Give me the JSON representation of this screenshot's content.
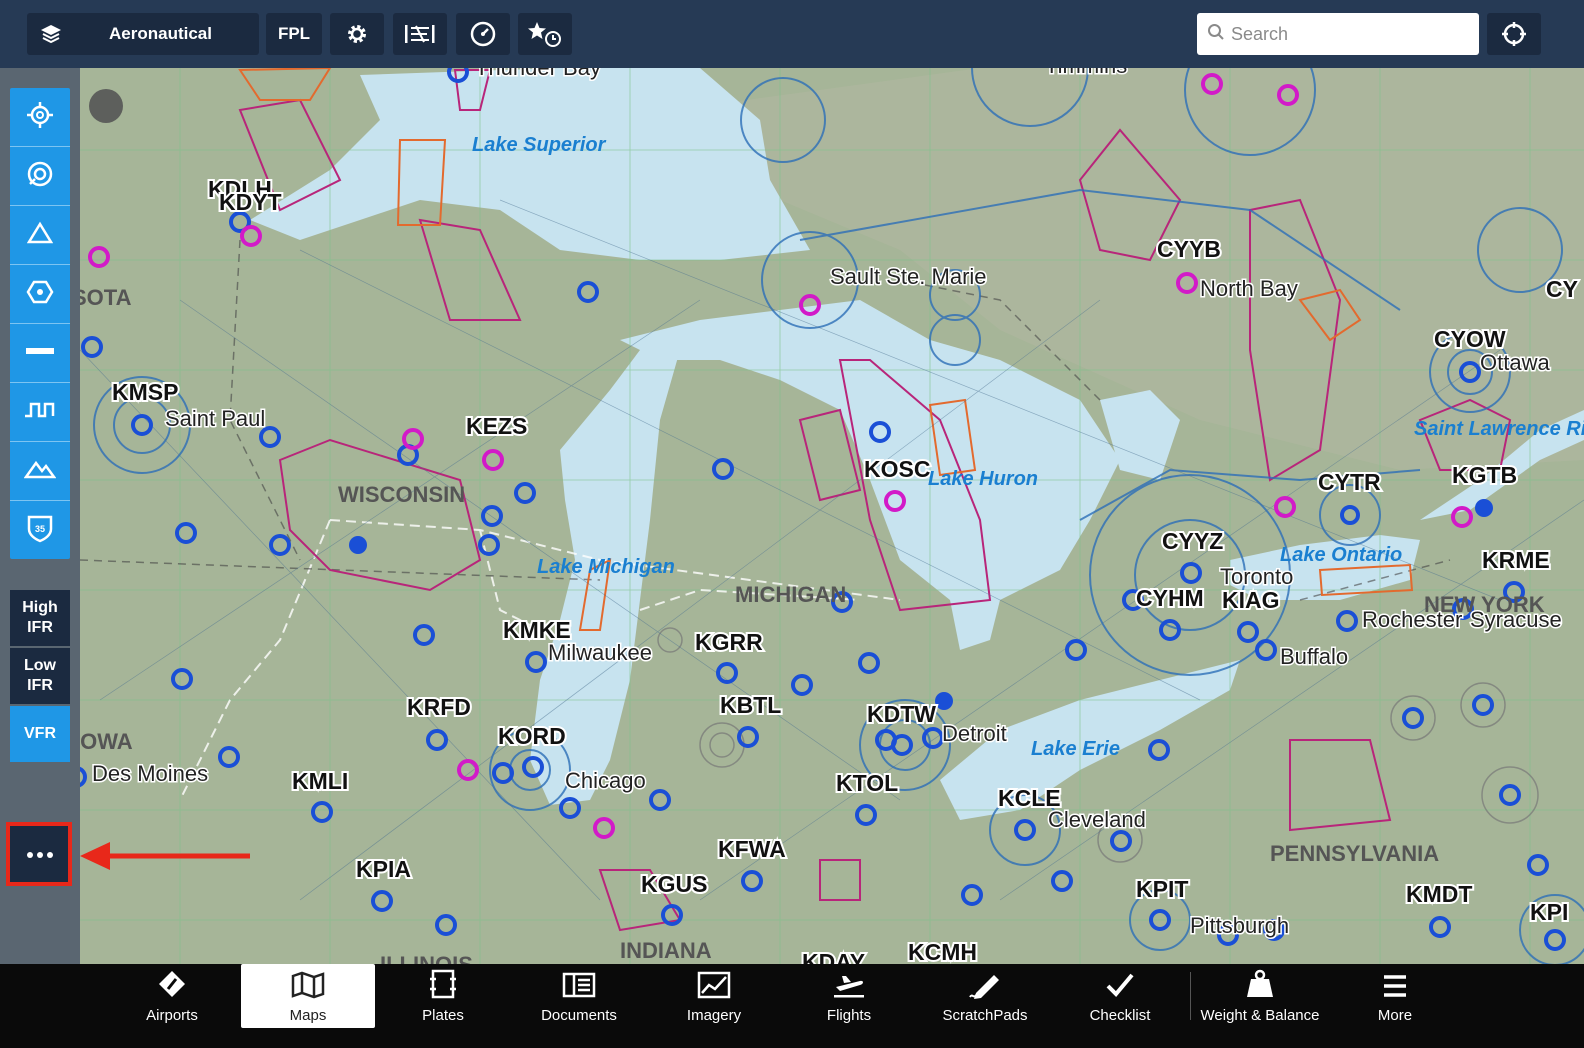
{
  "topbar": {
    "layers_label": "Aeronautical",
    "fpl_label": "FPL",
    "search_placeholder": "Search"
  },
  "left_rail": {
    "chart_types": [
      "High IFR",
      "Low IFR",
      "VFR"
    ],
    "active_chart": "VFR"
  },
  "map": {
    "airports": [
      "KDLH",
      "KDYT",
      "KMSP",
      "KEZS",
      "KOSC",
      "CYYB",
      "CYOW",
      "CYTR",
      "KGTB",
      "CYYZ",
      "CYHM",
      "KIAG",
      "KRME",
      "KMKE",
      "KGRR",
      "KBTL",
      "KDTW",
      "KRFD",
      "KORD",
      "KMLI",
      "KTOL",
      "KCLE",
      "KFWA",
      "KGUS",
      "KPIA",
      "KPIT",
      "KMDT",
      "KPI",
      "KDAY",
      "KCMH",
      "CY"
    ],
    "cities": [
      "Thunder Bay",
      "Sault Ste. Marie",
      "North Bay",
      "Ottawa",
      "Saint Paul",
      "Toronto",
      "Rochester",
      "Syracuse",
      "Buffalo",
      "Milwaukee",
      "Detroit",
      "Chicago",
      "Des Moines",
      "Cleveland",
      "Pittsburgh",
      "Timmins"
    ],
    "states": [
      "SOTA",
      "WISCONSIN",
      "MICHIGAN",
      "NEW YORK",
      "IOWA",
      "PENNSYLVANIA",
      "INDIANA",
      "ILLINOIS"
    ],
    "water": [
      "Lake Superior",
      "Lake Michigan",
      "Lake Huron",
      "Lake Erie",
      "Lake Ontario",
      "Saint Lawrence River"
    ]
  },
  "tabs": [
    {
      "label": "Airports",
      "icon": "airport-icon"
    },
    {
      "label": "Maps",
      "icon": "map-icon",
      "active": true
    },
    {
      "label": "Plates",
      "icon": "plates-icon"
    },
    {
      "label": "Documents",
      "icon": "documents-icon"
    },
    {
      "label": "Imagery",
      "icon": "imagery-icon"
    },
    {
      "label": "Flights",
      "icon": "flights-icon"
    },
    {
      "label": "ScratchPads",
      "icon": "scratchpad-icon"
    },
    {
      "label": "Checklist",
      "icon": "checklist-icon"
    },
    {
      "label": "Weight & Balance",
      "icon": "weight-icon"
    },
    {
      "label": "More",
      "icon": "more-menu-icon"
    }
  ],
  "colors": {
    "toolbar_bg": "#263a55",
    "accent_blue": "#1f97e6",
    "highlight_red": "#e8281a",
    "water": "#c7e3ef",
    "land": "#a6b598"
  }
}
